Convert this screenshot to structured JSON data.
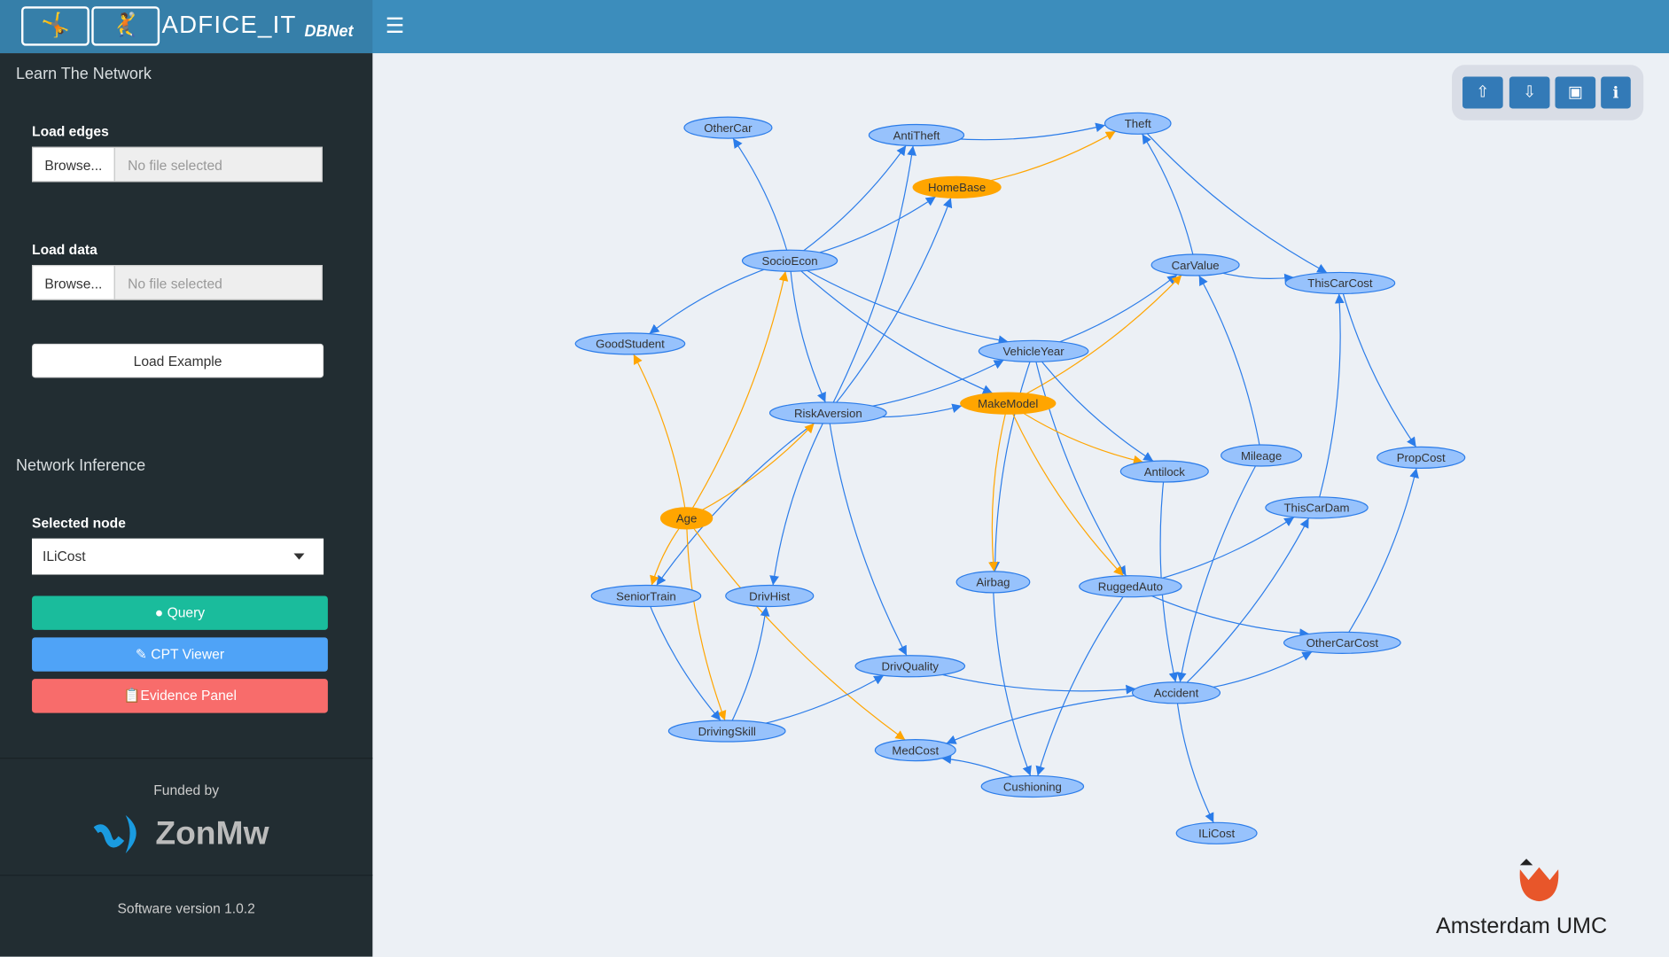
{
  "header": {
    "brand": "ADFICE_IT",
    "subtitle": "DBNet",
    "menu_icon": "hamburger-icon",
    "logo_icons": [
      "person-cursor-icon",
      "person-falling-icon"
    ]
  },
  "sidebar": {
    "learn_title": "Learn The Network",
    "load_edges": {
      "label": "Load edges",
      "button": "Browse...",
      "placeholder": "No file selected"
    },
    "load_data": {
      "label": "Load data",
      "button": "Browse...",
      "placeholder": "No file selected"
    },
    "load_example": "Load Example",
    "inference_title": "Network Inference",
    "selected_node": {
      "label": "Selected node",
      "value": "ILiCost"
    },
    "query": "Query",
    "cpt_viewer": "CPT Viewer",
    "evidence_panel": "Evidence Panel",
    "funded_by": "Funded by",
    "funder": "ZonMw",
    "version": "Software version 1.0.2"
  },
  "toolbar": {
    "buttons": [
      "upload-icon",
      "download-icon",
      "image-icon",
      "info-icon"
    ]
  },
  "colors": {
    "node": "#97c2fc",
    "node_border": "#2b7ce9",
    "highlight": "#ffa500",
    "edge": "#2b7ce9",
    "highlight_edge": "#ffa500",
    "query": "#1abc9c",
    "cpt": "#4fa3f7",
    "evidence": "#f86c6b"
  },
  "network": {
    "highlighted": [
      "HomeBase",
      "MakeModel",
      "Age"
    ],
    "nodes": [
      "OtherCar",
      "AntiTheft",
      "Theft",
      "HomeBase",
      "SocioEcon",
      "CarValue",
      "ThisCarCost",
      "GoodStudent",
      "VehicleYear",
      "MakeModel",
      "RiskAversion",
      "Antilock",
      "Mileage",
      "PropCost",
      "Age",
      "ThisCarDam",
      "Airbag",
      "RuggedAuto",
      "SeniorTrain",
      "DrivHist",
      "OtherCarCost",
      "DrivQuality",
      "Accident",
      "DrivingSkill",
      "MedCost",
      "Cushioning",
      "ILiCost"
    ],
    "edges": [
      [
        "SocioEcon",
        "OtherCar"
      ],
      [
        "SocioEcon",
        "AntiTheft"
      ],
      [
        "SocioEcon",
        "HomeBase"
      ],
      [
        "SocioEcon",
        "GoodStudent"
      ],
      [
        "SocioEcon",
        "VehicleYear"
      ],
      [
        "SocioEcon",
        "MakeModel"
      ],
      [
        "SocioEcon",
        "RiskAversion"
      ],
      [
        "AntiTheft",
        "Theft"
      ],
      [
        "HomeBase",
        "Theft"
      ],
      [
        "CarValue",
        "Theft"
      ],
      [
        "Theft",
        "ThisCarCost"
      ],
      [
        "CarValue",
        "ThisCarCost"
      ],
      [
        "ThisCarCost",
        "PropCost"
      ],
      [
        "VehicleYear",
        "CarValue"
      ],
      [
        "MakeModel",
        "CarValue"
      ],
      [
        "RiskAversion",
        "AntiTheft"
      ],
      [
        "RiskAversion",
        "HomeBase"
      ],
      [
        "RiskAversion",
        "VehicleYear"
      ],
      [
        "RiskAversion",
        "MakeModel"
      ],
      [
        "RiskAversion",
        "SeniorTrain"
      ],
      [
        "RiskAversion",
        "DrivHist"
      ],
      [
        "RiskAversion",
        "DrivQuality"
      ],
      [
        "Age",
        "GoodStudent"
      ],
      [
        "Age",
        "SocioEcon"
      ],
      [
        "Age",
        "RiskAversion"
      ],
      [
        "Age",
        "SeniorTrain"
      ],
      [
        "Age",
        "DrivingSkill"
      ],
      [
        "Age",
        "MedCost"
      ],
      [
        "VehicleYear",
        "Antilock"
      ],
      [
        "VehicleYear",
        "Airbag"
      ],
      [
        "VehicleYear",
        "RuggedAuto"
      ],
      [
        "MakeModel",
        "Antilock"
      ],
      [
        "MakeModel",
        "Airbag"
      ],
      [
        "MakeModel",
        "RuggedAuto"
      ],
      [
        "Mileage",
        "CarValue"
      ],
      [
        "Mileage",
        "Accident"
      ],
      [
        "Antilock",
        "Accident"
      ],
      [
        "ThisCarDam",
        "ThisCarCost"
      ],
      [
        "RuggedAuto",
        "ThisCarDam"
      ],
      [
        "RuggedAuto",
        "OtherCarCost"
      ],
      [
        "RuggedAuto",
        "Cushioning"
      ],
      [
        "Accident",
        "ThisCarDam"
      ],
      [
        "Accident",
        "OtherCarCost"
      ],
      [
        "Accident",
        "MedCost"
      ],
      [
        "Accident",
        "ILiCost"
      ],
      [
        "OtherCarCost",
        "PropCost"
      ],
      [
        "SeniorTrain",
        "DrivingSkill"
      ],
      [
        "DrivingSkill",
        "DrivHist"
      ],
      [
        "DrivingSkill",
        "DrivQuality"
      ],
      [
        "DrivQuality",
        "Accident"
      ],
      [
        "Airbag",
        "Cushioning"
      ],
      [
        "Cushioning",
        "MedCost"
      ]
    ]
  },
  "footer_logo": "Amsterdam UMC"
}
